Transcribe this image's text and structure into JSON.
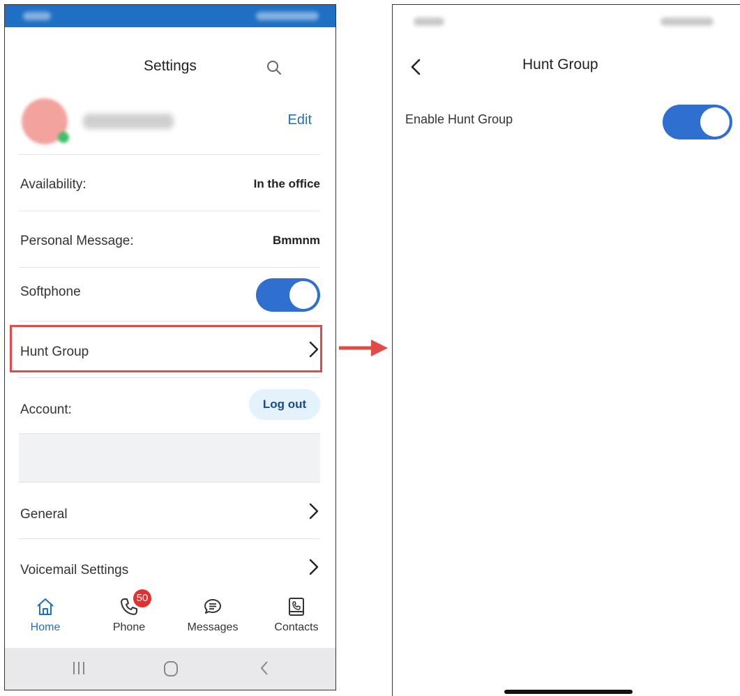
{
  "left_screen": {
    "header": {
      "title": "Settings"
    },
    "profile": {
      "edit_label": "Edit"
    },
    "rows": {
      "availability": {
        "label": "Availability:",
        "value": "In the office"
      },
      "personal_message": {
        "label": "Personal Message:",
        "value": "Bmmnm"
      },
      "softphone": {
        "label": "Softphone",
        "enabled": true
      },
      "hunt_group": {
        "label": "Hunt Group"
      },
      "account": {
        "label": "Account:",
        "button": "Log out"
      },
      "general": {
        "label": "General"
      },
      "voicemail": {
        "label": "Voicemail Settings"
      }
    },
    "tabs": [
      {
        "label": "Home",
        "icon": "home-icon",
        "active": true
      },
      {
        "label": "Phone",
        "icon": "phone-icon",
        "badge": "50"
      },
      {
        "label": "Messages",
        "icon": "chat-bubble-icon"
      },
      {
        "label": "Contacts",
        "icon": "contacts-book-icon"
      }
    ],
    "system_nav": [
      "recent-apps-icon",
      "home-circle-icon",
      "back-chevron-icon"
    ]
  },
  "right_screen": {
    "header": {
      "title": "Hunt Group"
    },
    "enable_hunt_group": {
      "label": "Enable Hunt Group",
      "enabled": true
    }
  },
  "colors": {
    "brand_blue": "#1f6fc5",
    "toggle_blue": "#2f6fcf",
    "highlight_red": "#e24a47",
    "badge_red": "#e0322f"
  }
}
